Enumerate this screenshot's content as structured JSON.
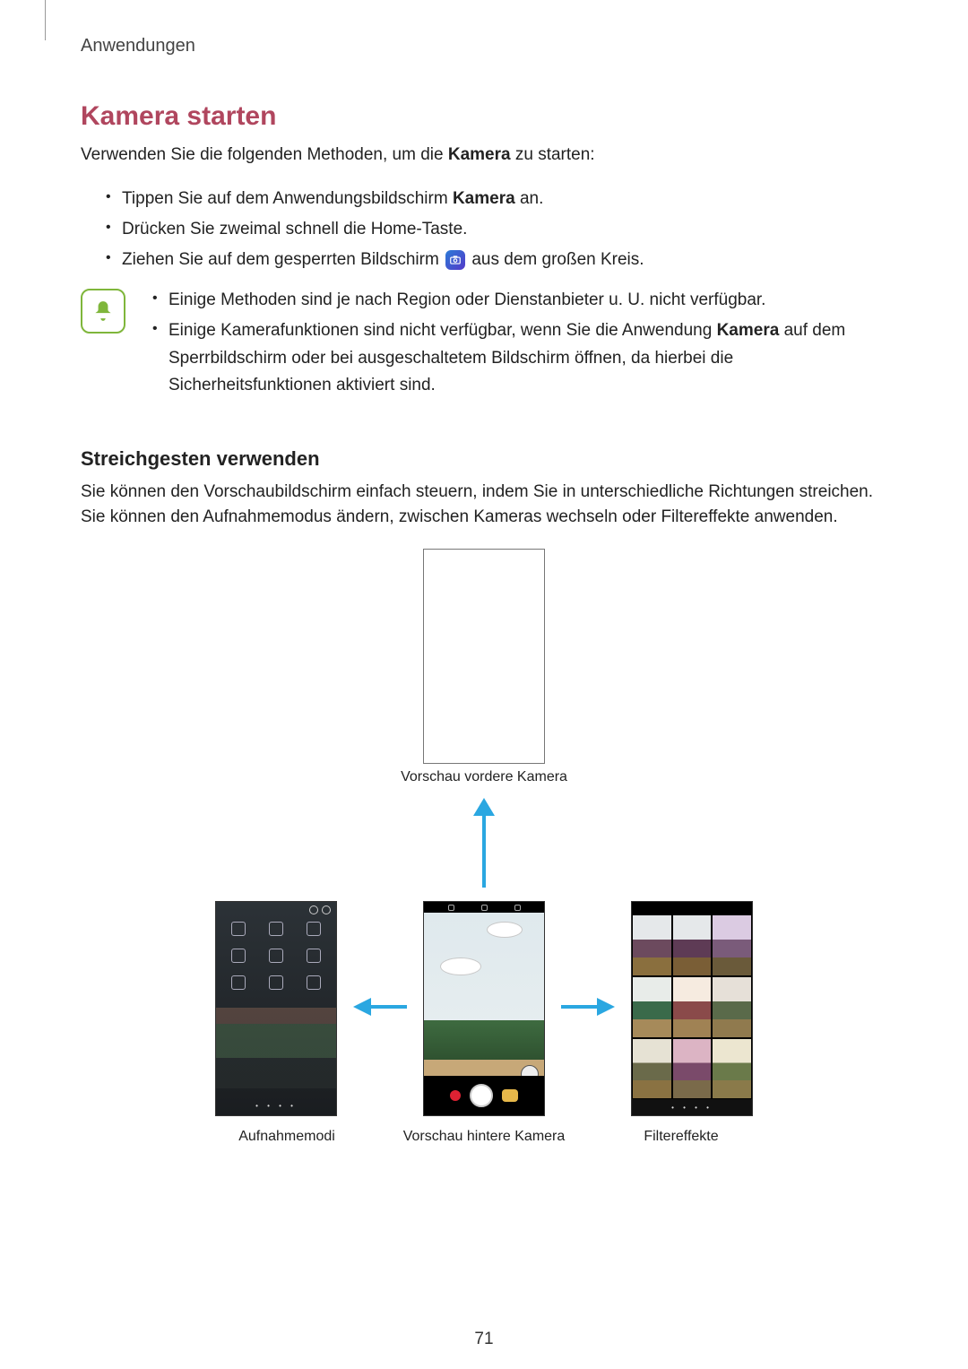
{
  "breadcrumb": "Anwendungen",
  "h1": "Kamera starten",
  "intro_pre": "Verwenden Sie die folgenden Methoden, um die ",
  "intro_bold": "Kamera",
  "intro_post": " zu starten:",
  "bullets": {
    "b1_pre": "Tippen Sie auf dem Anwendungsbildschirm ",
    "b1_bold": "Kamera",
    "b1_post": " an.",
    "b2": "Drücken Sie zweimal schnell die Home-Taste.",
    "b3_pre": "Ziehen Sie auf dem gesperrten Bildschirm ",
    "b3_post": " aus dem großen Kreis."
  },
  "note": {
    "n1": "Einige Methoden sind je nach Region oder Dienstanbieter u. U. nicht verfügbar.",
    "n2_pre": "Einige Kamerafunktionen sind nicht verfügbar, wenn Sie die Anwendung ",
    "n2_bold": "Kamera",
    "n2_post": " auf dem Sperrbildschirm oder bei ausgeschaltetem Bildschirm öffnen, da hierbei die Sicherheitsfunktionen aktiviert sind."
  },
  "h2": "Streichgesten verwenden",
  "body": "Sie können den Vorschaubildschirm einfach steuern, indem Sie in unterschiedliche Richtungen streichen. Sie können den Aufnahmemodus ändern, zwischen Kameras wechseln oder Filtereffekte anwenden.",
  "captions": {
    "frontPreview": "Vorschau vordere Kamera",
    "modes": "Aufnahmemodi",
    "rearPreview": "Vorschau hintere Kamera",
    "filters": "Filtereffekte"
  },
  "pageNumber": "71",
  "colors": {
    "accent": "#b0465e",
    "arrow": "#2aa7e1",
    "noteBorder": "#7fb63b"
  }
}
